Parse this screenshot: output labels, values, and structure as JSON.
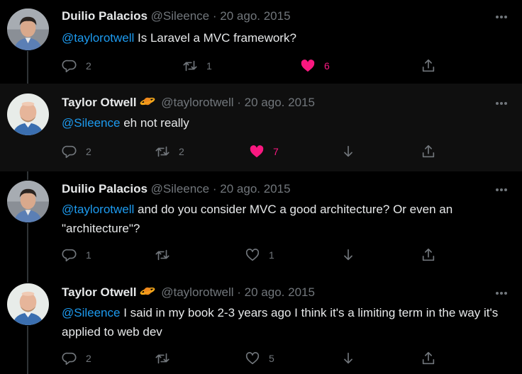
{
  "colors": {
    "background": "#000000",
    "mention": "#1d9bf0",
    "like_active": "#f91880",
    "muted": "#71767b"
  },
  "tweets": [
    {
      "author_name": "Duilio Palacios",
      "handle": "@Sileence",
      "separator": "·",
      "date": "20 ago. 2015",
      "mention": "@taylorotwell",
      "body": " Is Laravel a MVC framework?",
      "replies": "2",
      "retweets": "1",
      "likes": "6",
      "liked": true
    },
    {
      "author_name": "Taylor Otwell",
      "author_emoji_icon": "ringed-planet-icon",
      "handle": "@taylorotwell",
      "separator": "·",
      "date": "20 ago. 2015",
      "mention": "@Sileence",
      "body": " eh not really",
      "replies": "2",
      "retweets": "2",
      "likes": "7",
      "liked": true
    },
    {
      "author_name": "Duilio Palacios",
      "handle": "@Sileence",
      "separator": "·",
      "date": "20 ago. 2015",
      "mention": "@taylorotwell",
      "body": " and do you consider MVC a good architecture? Or even an \"architecture\"?",
      "replies": "1",
      "retweets": "",
      "likes": "1",
      "liked": false
    },
    {
      "author_name": "Taylor Otwell",
      "author_emoji_icon": "ringed-planet-icon",
      "handle": "@taylorotwell",
      "separator": "·",
      "date": "20 ago. 2015",
      "mention": "@Sileence",
      "body": " I said in my book 2-3 years ago I think it's a limiting term in the way it's applied to web dev",
      "replies": "2",
      "retweets": "",
      "likes": "5",
      "liked": false
    }
  ]
}
